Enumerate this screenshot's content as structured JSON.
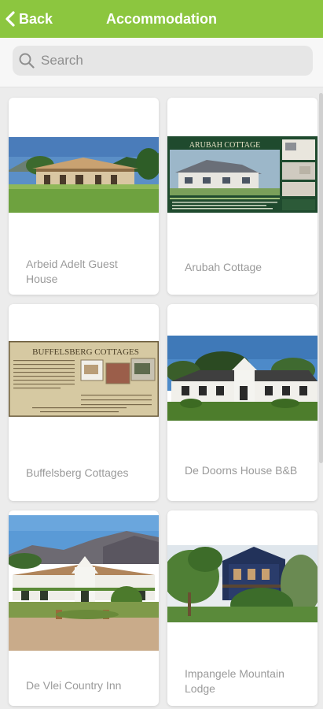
{
  "header": {
    "back_label": "Back",
    "title": "Accommodation"
  },
  "search": {
    "placeholder": "Search",
    "value": ""
  },
  "cards": [
    {
      "name": "Arbeid Adelt Guest House",
      "image_text": ""
    },
    {
      "name": "Arubah Cottage",
      "image_text": "ARUBAH COTTAGE"
    },
    {
      "name": "Buffelsberg Cottages",
      "image_text": "BUFFELSBERG COTTAGES"
    },
    {
      "name": "De Doorns House B&B",
      "image_text": ""
    },
    {
      "name": "De Vlei Country Inn",
      "image_text": ""
    },
    {
      "name": "Impangele Mountain Lodge",
      "image_text": ""
    }
  ],
  "colors": {
    "header": "#8cc63f",
    "card_text": "#9a9a9a"
  }
}
